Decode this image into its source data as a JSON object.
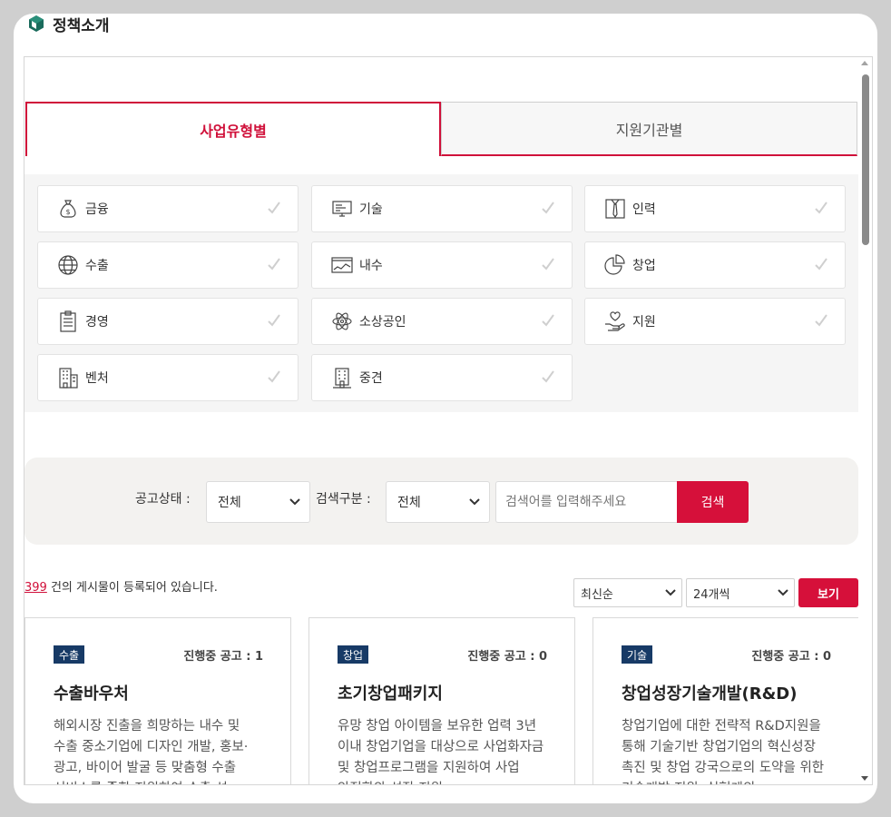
{
  "dialog": {
    "title": "정책소개"
  },
  "tabs": [
    {
      "label": "사업유형별",
      "active": true
    },
    {
      "label": "지원기관별",
      "active": false
    }
  ],
  "categories": [
    {
      "label": "금융",
      "icon": "money-bag-icon"
    },
    {
      "label": "기술",
      "icon": "monitor-code-icon"
    },
    {
      "label": "인력",
      "icon": "tie-icon"
    },
    {
      "label": "수출",
      "icon": "globe-icon"
    },
    {
      "label": "내수",
      "icon": "chart-window-icon"
    },
    {
      "label": "창업",
      "icon": "pie-chart-icon"
    },
    {
      "label": "경영",
      "icon": "clipboard-icon"
    },
    {
      "label": "소상공인",
      "icon": "atom-icon"
    },
    {
      "label": "지원",
      "icon": "heart-hand-icon"
    },
    {
      "label": "벤처",
      "icon": "building-icon"
    },
    {
      "label": "중견",
      "icon": "office-icon"
    }
  ],
  "search": {
    "status_label": "공고상태 :",
    "status_value": "전체",
    "type_label": "검색구분 :",
    "type_value": "전체",
    "placeholder": "검색어를 입력해주세요",
    "button": "검색"
  },
  "results": {
    "count": "399",
    "count_suffix": " 건의 게시물이 등록되어 있습니다.",
    "sort_value": "최신순",
    "per_page_value": "24개씩",
    "view_button": "보기"
  },
  "cards": [
    {
      "badge": "수출",
      "status": "진행중 공고 : 1",
      "title": "수출바우처",
      "desc": "해외시장 진출을 희망하는 내수 및 수출 중소기업에 디자인 개발, 홍보·광고, 바이어 발굴 등 맞춤형 수출 서비스를 종합 지원하여 수출 성"
    },
    {
      "badge": "창업",
      "status": "진행중 공고 : 0",
      "title": "초기창업패키지",
      "desc": "유망 창업 아이템을 보유한 업력 3년 이내 창업기업을 대상으로 사업화자금 및 창업프로그램을 지원하여 사업 안정화와 성장 지원"
    },
    {
      "badge": "기술",
      "status": "진행중 공고 : 0",
      "title": "창업성장기술개발(R&D)",
      "desc": "창업기업에 대한 전략적 R&D지원을 통해 기술기반 창업기업의 혁신성장 촉진 및 창업 강국으로의 도약을 위한 기술개발 지원, 실현계의"
    }
  ],
  "colors": {
    "accent": "#d6103a",
    "badge": "#173a66"
  }
}
